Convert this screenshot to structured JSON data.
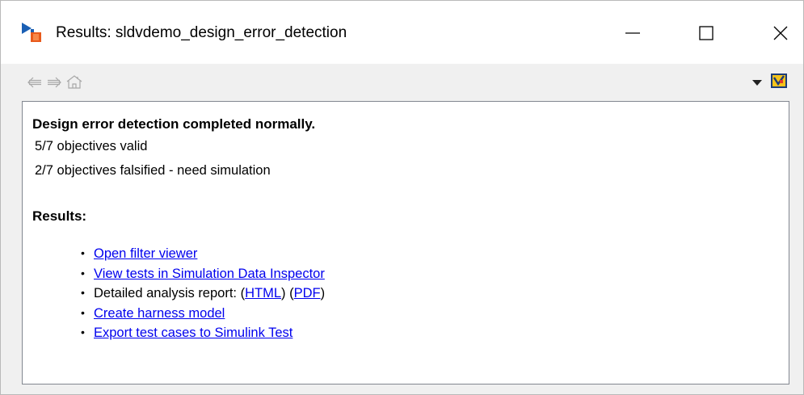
{
  "window": {
    "title": "Results: sldvdemo_design_error_detection"
  },
  "toolbar": {
    "back_icon": "back-arrow-icon",
    "forward_icon": "forward-arrow-icon",
    "home_icon": "home-icon",
    "menu_icon": "dropdown-triangle-icon",
    "sldv_icon": "design-verifier-icon"
  },
  "summary": {
    "heading": "Design error detection completed normally.",
    "lines": [
      "5/7 objectives valid",
      "2/7 objectives falsified - need simulation"
    ]
  },
  "results": {
    "heading": "Results:",
    "items": [
      {
        "link": "Open filter viewer"
      },
      {
        "link": "View tests in Simulation Data Inspector"
      },
      {
        "prefix": "Detailed analysis report: (",
        "html": "HTML",
        "mid": ") (",
        "pdf": "PDF",
        "suffix": ")"
      },
      {
        "link": "Create harness model"
      },
      {
        "link": "Export test cases to Simulink Test"
      }
    ],
    "bullet": "•"
  },
  "colors": {
    "link": "#0000ee",
    "icon_blue": "#1a5fb4",
    "icon_orange": "#e85a1c",
    "toolbar_disabled": "#a0a0a0"
  }
}
